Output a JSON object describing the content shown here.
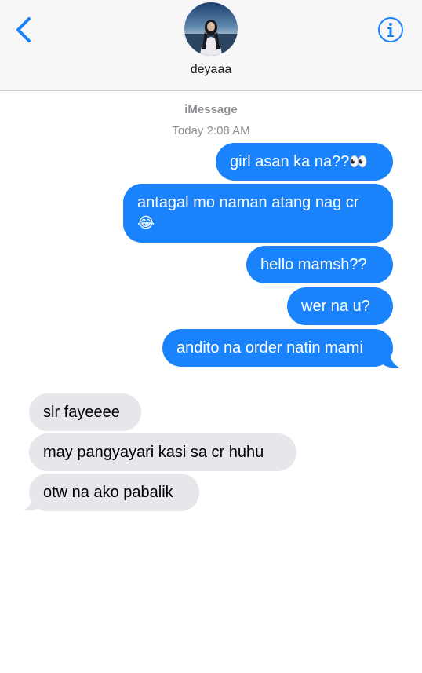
{
  "header": {
    "contact_name": "deyaaa"
  },
  "conversation": {
    "service_label": "iMessage",
    "timestamp": "Today 2:08 AM"
  },
  "messages": {
    "sent": [
      {
        "text": "girl asan ka na??",
        "emoji": "👀"
      },
      {
        "text": "antagal mo naman atang nag cr",
        "emoji": "😂"
      },
      {
        "text": "hello mamsh??"
      },
      {
        "text": "wer na u?"
      },
      {
        "text": "andito na order natin mami"
      }
    ],
    "received": [
      {
        "text": "slr fayeeee"
      },
      {
        "text": "may pangyayari kasi sa cr huhu"
      },
      {
        "text": "otw na ako pabalik"
      }
    ]
  },
  "colors": {
    "sent_bubble": "#1a82fb",
    "received_bubble": "#e6e6eb",
    "accent": "#1a82fb",
    "meta_text": "#8e8e93"
  },
  "icons": {
    "back": "chevron-left-icon",
    "info": "info-circle-icon"
  }
}
